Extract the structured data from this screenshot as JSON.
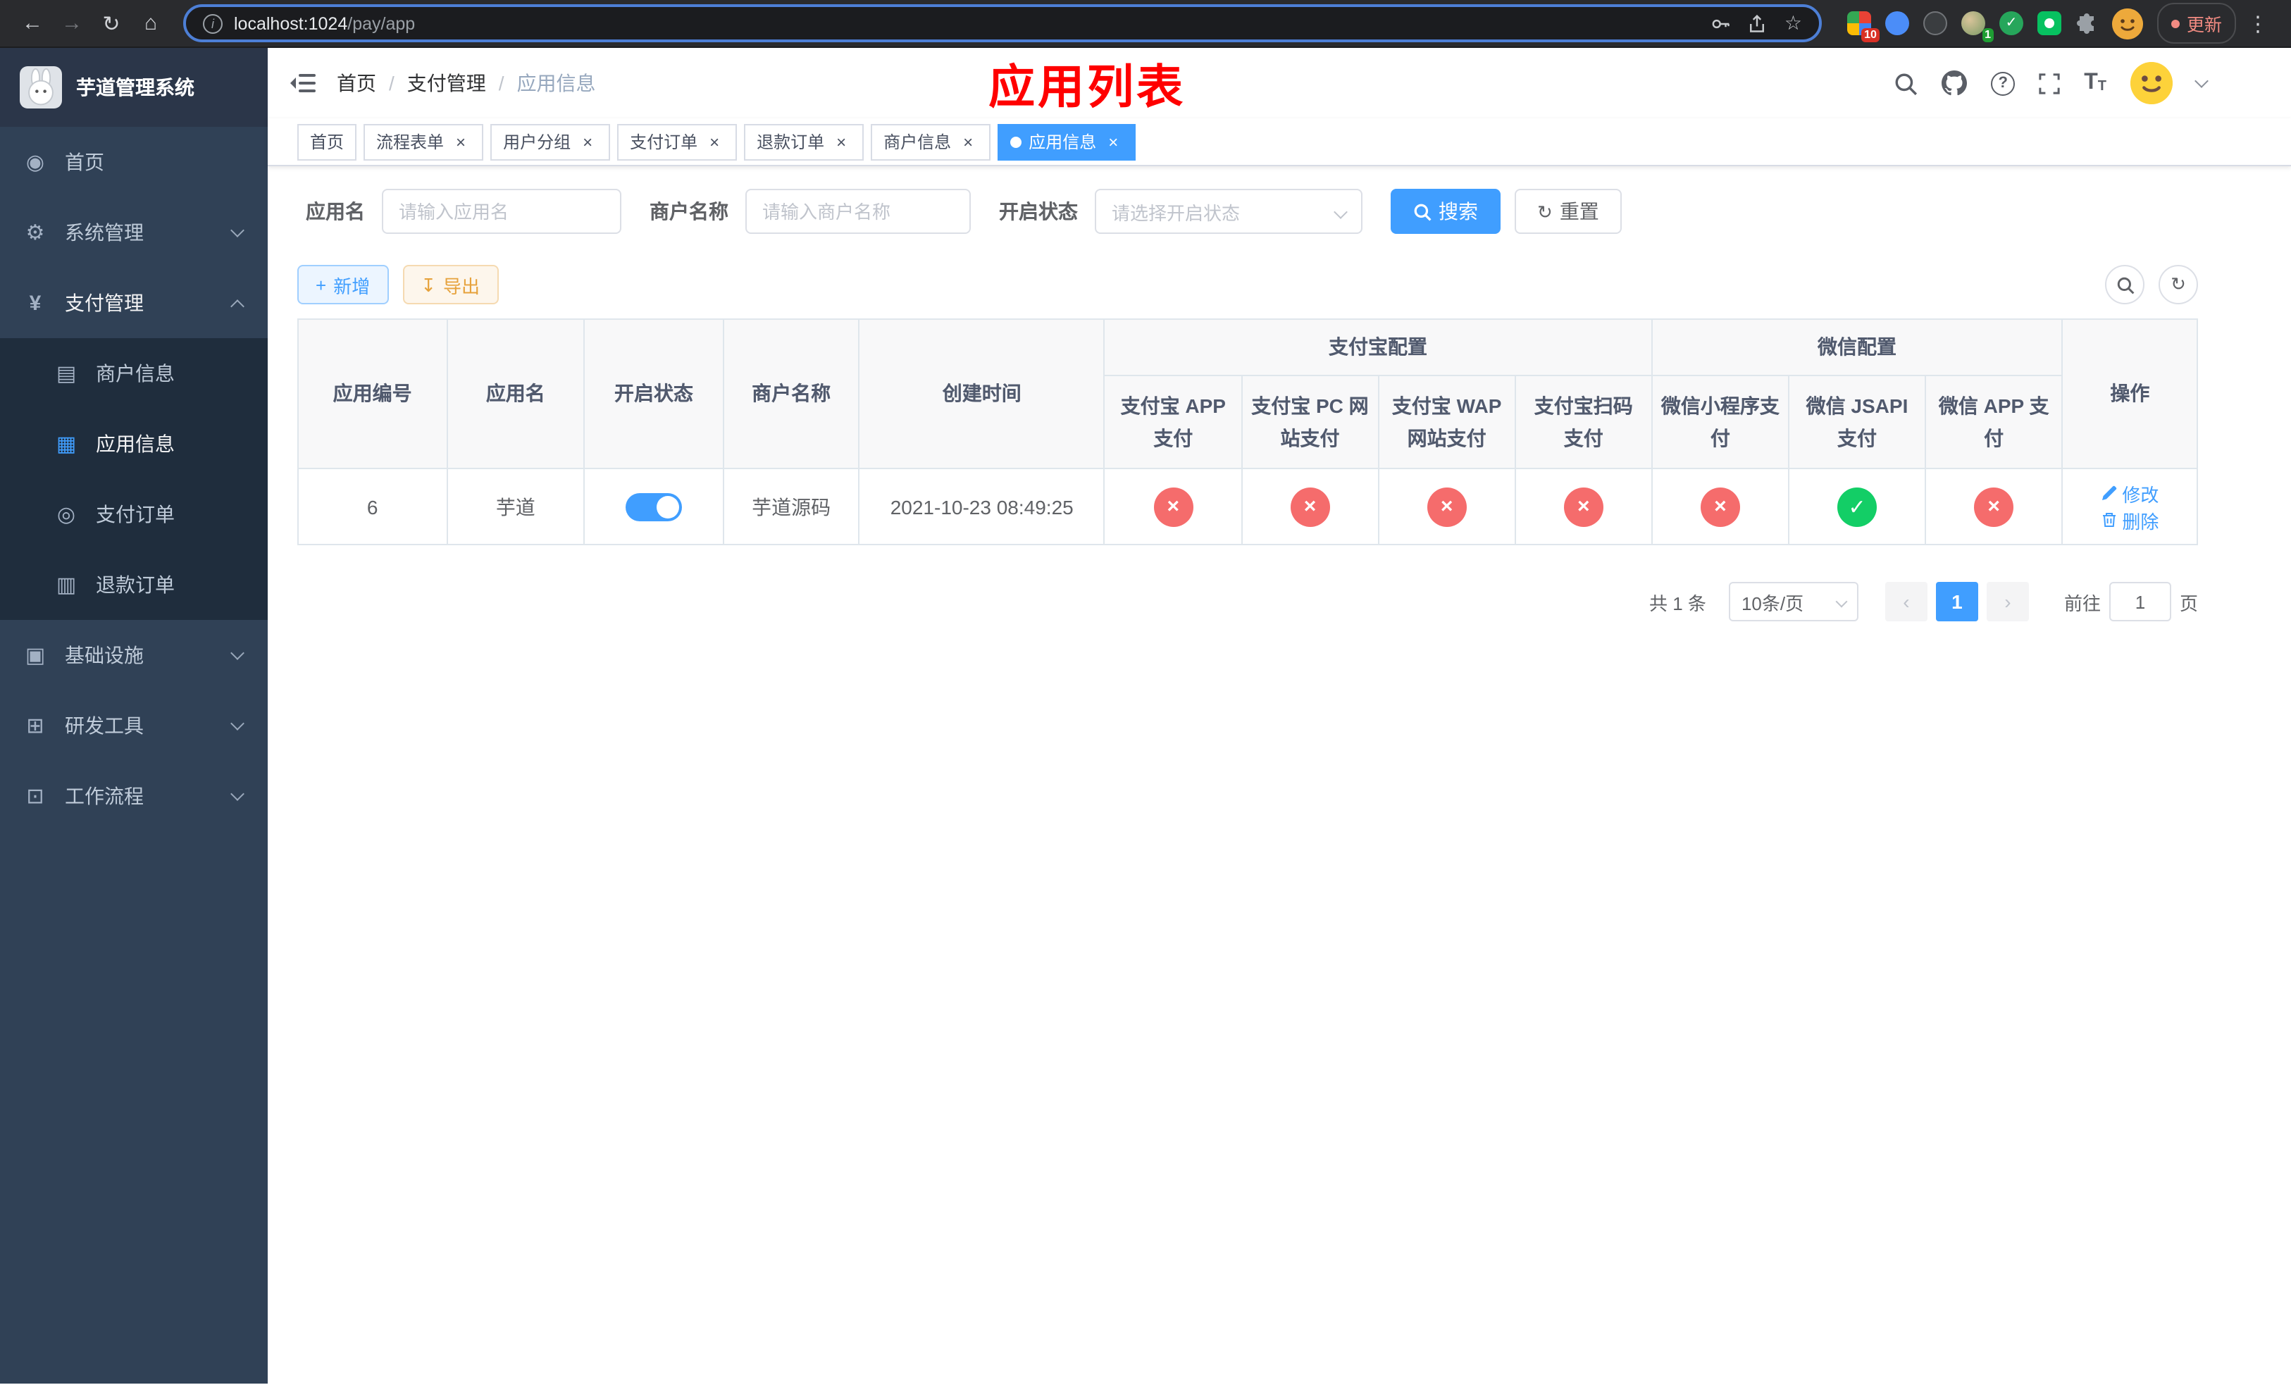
{
  "colors": {
    "accent": "#409eff",
    "danger": "#f56c6c",
    "success": "#13ce66",
    "warning": "#e6a23c",
    "page_title_red": "#ff0000",
    "sidebar_bg": "#304156",
    "submenu_bg": "#1f2d3d"
  },
  "icons": {
    "back": "←",
    "forward": "→",
    "reload": "↻",
    "home": "⌂",
    "info": "i",
    "star": "☆",
    "dots": "⋮",
    "dashboard": "◉",
    "system": "⚙",
    "payment": "¥",
    "merchant": "▤",
    "app_menu": "▦",
    "order": "◎",
    "refund": "▥",
    "infra": "▣",
    "devtools": "⊞",
    "workflow": "⊡",
    "question": "?",
    "font_size": "T",
    "plus": "+",
    "download": "↧",
    "refresh": "↻",
    "cross": "×",
    "check": "✓",
    "prev": "‹",
    "next": "›"
  },
  "browser": {
    "url_host": "localhost:1024",
    "url_path": "/pay/app",
    "update_label": "更新",
    "badges": {
      "red": "10",
      "green": "1"
    }
  },
  "sidebar": {
    "title": "芋道管理系统",
    "items": [
      {
        "label": "首页"
      },
      {
        "label": "系统管理"
      },
      {
        "label": "支付管理"
      },
      {
        "label": "基础设施"
      },
      {
        "label": "研发工具"
      },
      {
        "label": "工作流程"
      }
    ],
    "pay_children": [
      {
        "label": "商户信息"
      },
      {
        "label": "应用信息"
      },
      {
        "label": "支付订单"
      },
      {
        "label": "退款订单"
      }
    ]
  },
  "header": {
    "breadcrumb": [
      {
        "label": "首页"
      },
      {
        "label": "支付管理"
      },
      {
        "label": "应用信息"
      }
    ],
    "breadcrumb_separator": "/",
    "title": "应用列表"
  },
  "tabs": [
    {
      "label": "首页"
    },
    {
      "label": "流程表单"
    },
    {
      "label": "用户分组"
    },
    {
      "label": "支付订单"
    },
    {
      "label": "退款订单"
    },
    {
      "label": "商户信息"
    },
    {
      "label": "应用信息"
    }
  ],
  "filters": {
    "app_name": {
      "label": "应用名",
      "placeholder": "请输入应用名"
    },
    "merchant_name": {
      "label": "商户名称",
      "placeholder": "请输入商户名称"
    },
    "status": {
      "label": "开启状态",
      "placeholder": "请选择开启状态"
    },
    "search": "搜索",
    "reset": "重置"
  },
  "toolbar": {
    "add": "新增",
    "export": "导出"
  },
  "table": {
    "headers": {
      "app_id": "应用编号",
      "app_name": "应用名",
      "status": "开启状态",
      "merchant_name": "商户名称",
      "create_time": "创建时间",
      "alipay_group": "支付宝配置",
      "wechat_group": "微信配置",
      "alipay_app": "支付宝 APP 支付",
      "alipay_pc": "支付宝 PC 网站支付",
      "alipay_wap": "支付宝 WAP 网站支付",
      "alipay_qr": "支付宝扫码支付",
      "wechat_mini": "微信小程序支付",
      "wechat_jsapi": "微信 JSAPI 支付",
      "wechat_app": "微信 APP 支付",
      "actions": "操作"
    },
    "row": {
      "app_id": "6",
      "app_name": "芋道",
      "status_on": true,
      "merchant_name": "芋道源码",
      "create_time": "2021-10-23 08:49:25",
      "configs": {
        "alipay_app": "disabled",
        "alipay_pc": "disabled",
        "alipay_wap": "disabled",
        "alipay_qr": "disabled",
        "wechat_mini": "disabled",
        "wechat_jsapi": "enabled",
        "wechat_app": "disabled"
      },
      "edit": "修改",
      "delete": "删除"
    }
  },
  "pagination": {
    "total": "共 1 条",
    "page_size": "10条/页",
    "current_page": "1",
    "goto_label": "前往",
    "goto_value": "1",
    "goto_unit": "页"
  }
}
